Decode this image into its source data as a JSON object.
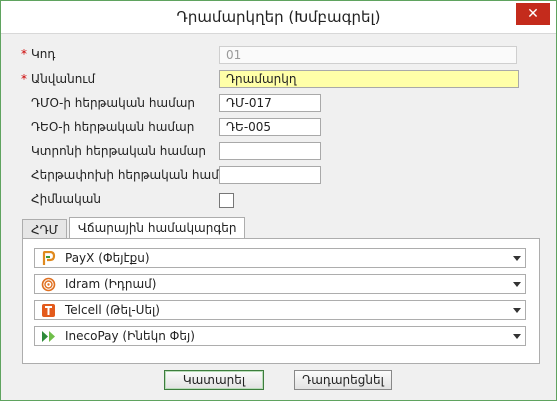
{
  "window": {
    "title": "Դրամարկղեր (Խմբագրել)",
    "close_symbol": "✕"
  },
  "form": {
    "code": {
      "label": "Կոդ",
      "value": "01",
      "required": true
    },
    "name": {
      "label": "Անվանում",
      "value": "Դրամարկղ",
      "required": true
    },
    "dmo_number": {
      "label": "ԴՄՕ-ի հերթական համար",
      "value": "ԴՄ-017"
    },
    "deo_number": {
      "label": "ԴԵՕ-ի հերթական համար",
      "value": "ԴԵ-005"
    },
    "check_number": {
      "label": "Կտրոնի հերթական համար",
      "value": ""
    },
    "refund_number": {
      "label": "Հերթափոխի հերթական համար",
      "value": ""
    },
    "primary": {
      "label": "Հիմնական",
      "checked": false
    },
    "required_mark": "*"
  },
  "tabs": [
    {
      "label": "ՀԴՄ",
      "active": false
    },
    {
      "label": "Վճարային համակարգեր",
      "active": true
    }
  ],
  "payment_systems": [
    {
      "label": "PayX (Փեյէքս)",
      "icon": "payx-icon",
      "color": "#e08a1e"
    },
    {
      "label": "Idram (Իդրամ)",
      "icon": "idram-icon",
      "color": "#e07020"
    },
    {
      "label": "Telcell (Թել-Սել)",
      "icon": "telcell-icon",
      "color": "#e35a1c"
    },
    {
      "label": "InecoPay (Ինեկո Փեյ)",
      "icon": "inecopay-icon",
      "color": "#2e8b3a"
    }
  ],
  "buttons": {
    "ok": "Կատարել",
    "cancel": "Դադարեցնել"
  },
  "colors": {
    "accent_red": "#d42020",
    "name_field_bg": "#ffffa8",
    "frame_green": "#5fa35f"
  }
}
